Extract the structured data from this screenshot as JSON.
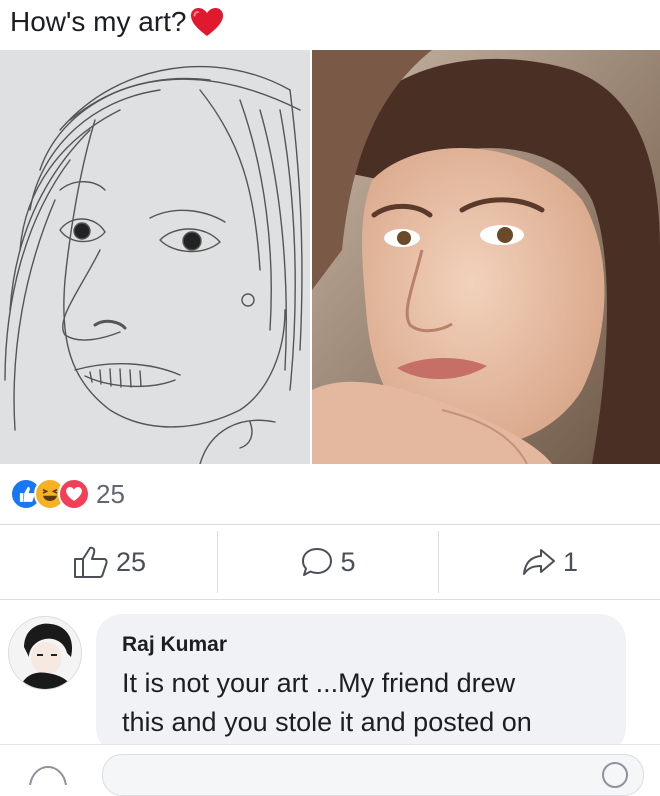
{
  "post": {
    "caption": "How's my art?",
    "caption_emoji": "red-heart-icon"
  },
  "reactions": {
    "icons": [
      "like-icon",
      "haha-icon",
      "love-icon"
    ],
    "count": "25",
    "colors": {
      "like": "#1877f2",
      "haha": "#f7b125",
      "love": "#f33e58"
    }
  },
  "actions": {
    "like_count": "25",
    "comment_count": "5",
    "share_count": "1"
  },
  "comment": {
    "author": "Raj Kumar",
    "text_line1": "It is not your art ...My friend drew",
    "text_line2": "this and you stole it and posted on"
  }
}
